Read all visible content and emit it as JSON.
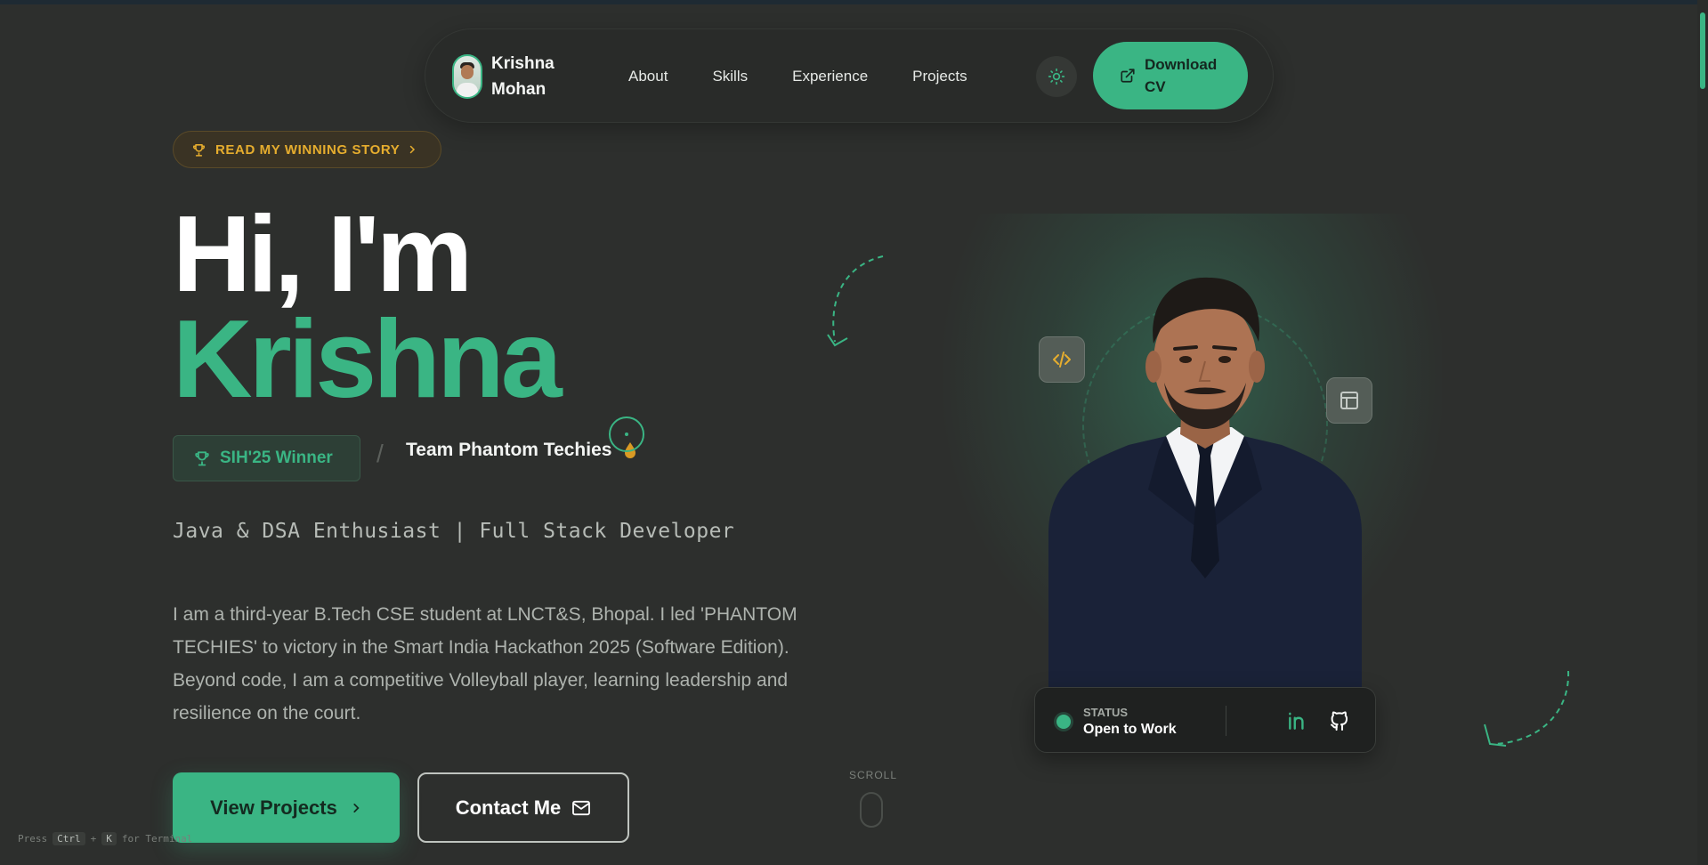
{
  "nav": {
    "brand": "Krishna Mohan",
    "links": [
      "About",
      "Skills",
      "Experience",
      "Projects"
    ],
    "download_label": "Download CV"
  },
  "hero": {
    "story_badge": "READ MY WINNING STORY",
    "greeting": "Hi, I'm",
    "name": "Krishna",
    "winner_badge": "SIH'25 Winner",
    "separator": "/",
    "team": "Team Phantom Techies",
    "role": "Java & DSA Enthusiast | Full Stack Developer",
    "bio": "I am a third-year B.Tech CSE student at LNCT&S, Bhopal. I led 'PHANTOM TECHIES' to victory in the Smart India Hackathon 2025 (Software Edition). Beyond code, I am a competitive Volleyball player, learning leadership and resilience on the court.",
    "primary_cta": "View Projects",
    "secondary_cta": "Contact Me",
    "scroll_label": "SCROLL"
  },
  "status": {
    "label": "STATUS",
    "value": "Open to Work"
  },
  "terminal_hint": {
    "prefix": "Press",
    "key1": "Ctrl",
    "plus": "+",
    "key2": "K",
    "suffix": "for Terminal"
  },
  "colors": {
    "accent": "#3ab584",
    "background": "#2d2f2d",
    "badge_gold": "#e6ad2e"
  },
  "icons": [
    "trophy-icon",
    "chevron-right-icon",
    "sun-icon",
    "external-link-icon",
    "mail-icon",
    "code-icon",
    "layout-icon",
    "linkedin-icon",
    "github-icon",
    "drop-icon"
  ]
}
